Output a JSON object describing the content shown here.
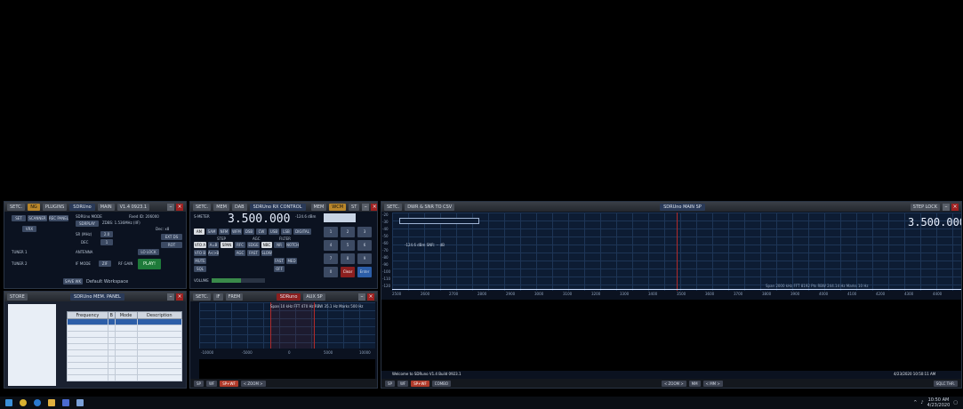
{
  "control_pane": {
    "title_buttons": [
      "SETC.",
      "NG",
      "PLUGINS",
      "SDRUno",
      "MAIN"
    ],
    "version": "V1.4 0923.1",
    "buttons": [
      "SET",
      "SCANNER",
      "REC PANEL",
      "SDRUno MODE",
      "VRX",
      "PLAY!",
      "SDRPLAY",
      "EXT DS",
      "ROT",
      "LO LOCK",
      "RF GAIN",
      "SAVE WK",
      "Default Workspace"
    ],
    "labels": [
      "Fixed ID: 206000",
      "ZDBS: 1.536MHz (IIF)",
      "Dec: x8",
      "SR (MHz)",
      "DEC",
      "TUNER 1",
      "TUNER 2",
      "ANTENNA",
      "IF MODE",
      "ZIF"
    ],
    "sr_value": "2.0",
    "dec_value": "1"
  },
  "rx_control": {
    "title_buttons": [
      "SETC.",
      "MEM",
      "DAB",
      "SDRUno RX CONTROL",
      "MEM",
      "WCM",
      "ST"
    ],
    "frequency": "3.500.000",
    "level": "-124.6 dBm",
    "modes": [
      "AM",
      "SAM",
      "NFM",
      "WFM",
      "DSB",
      "CW",
      "USB",
      "LSB",
      "DIGITAL",
      "MUTE",
      "SQL",
      "VFO A",
      "VFO B",
      "A=B",
      "A<>B",
      "SPAN",
      "RFC",
      "EDGE",
      "NBC",
      "NR",
      "NOTCH",
      "AGC",
      "FAST",
      "SLOW",
      "FAST",
      "MED",
      "OFF",
      "VOLUME"
    ],
    "keypad": [
      "1",
      "2",
      "3",
      "4",
      "5",
      "6",
      "7",
      "8",
      "9",
      "0",
      "Clear",
      "Enter"
    ],
    "small_labels": [
      "S-METER",
      "STEP",
      "AGC",
      "FILTER",
      "NR",
      "NB"
    ]
  },
  "main_spectrum": {
    "title_buttons": [
      "SETC.",
      "DWR & SNR TO CSV"
    ],
    "center_title": "SDRUno MAIN SP",
    "step_lock": "STEP LOCK",
    "frequency": "3.500.000",
    "db_ticks": [
      "-20",
      "-30",
      "-40",
      "-50",
      "-60",
      "-70",
      "-80",
      "-90",
      "-100",
      "-110",
      "-120"
    ],
    "freq_ticks": [
      "2500",
      "2600",
      "2700",
      "2800",
      "2900",
      "3000",
      "3100",
      "3200",
      "3300",
      "3400",
      "3500",
      "3600",
      "3700",
      "3800",
      "3900",
      "4000",
      "4100",
      "4200",
      "4300",
      "4400"
    ],
    "info_left": "-124.6 dBm   SNR: -- dB",
    "info_right": "Span 2000 kHz  FFT 8192 Pts  RBW 244.14 Hz  Marks 10 Hz",
    "status": "Welcome to SDRuno V1.4 Build 0923.1",
    "datetime": "4/23/2020 10:50:11 AM",
    "bottom_buttons": [
      "SP",
      "WF",
      "SP+WF",
      "COMBO"
    ],
    "zoom_buttons": [
      "< ZOOM >",
      "MM",
      "< MM >"
    ],
    "sqlc_thr": "SQLC THR."
  },
  "memory_panel": {
    "store_label": "STORE",
    "title": "SDRUno MEM. PANEL",
    "columns": [
      "Frequency",
      "B",
      "Mode",
      "Description"
    ]
  },
  "aux_spectrum": {
    "title_buttons": [
      "SETC.",
      "IF",
      "FREM"
    ],
    "title": "SDRuno",
    "sub_title": "AUX SP",
    "info": "Span 10 kHz  FFT 470 Hz  RBW 35.1 Hz  Marks 500 Hz",
    "ticks": [
      "-10000",
      "-5000",
      "0",
      "5000",
      "10000"
    ],
    "bottom_buttons": [
      "SP",
      "WF",
      "SP+WF",
      "< ZOOM >"
    ]
  },
  "taskbar": {
    "time": "10:50 AM",
    "date": "4/23/2020"
  },
  "colors": {
    "background": "#000000",
    "panel": "#0b1220",
    "spectrum_grid": "#1d3556",
    "center_marker": "#b02a2a",
    "accent": "#b8862a"
  }
}
